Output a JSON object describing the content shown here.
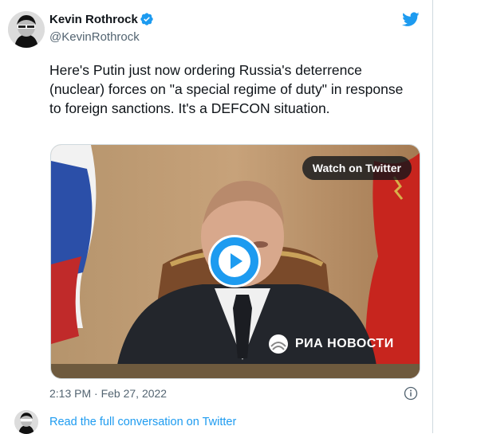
{
  "author": {
    "display_name": "Kevin Rothrock",
    "handle": "@KevinRothrock",
    "verified": true
  },
  "tweet": {
    "text": "Here's Putin just now ordering Russia's deterrence (nuclear) forces on \"a special regime of duty\" in response to foreign sanctions. It's a DEFCON situation.",
    "timestamp": "2:13 PM · Feb 27, 2022"
  },
  "media": {
    "watch_label": "Watch on Twitter",
    "watermark": "РИА НОВОСТИ"
  },
  "footer": {
    "read_link": "Read the full conversation on Twitter"
  },
  "colors": {
    "accent": "#1d9bf0",
    "secondary_text": "#536471"
  },
  "icons": [
    "avatar",
    "verified-badge-icon",
    "twitter-bird-icon",
    "play-icon",
    "info-icon"
  ]
}
